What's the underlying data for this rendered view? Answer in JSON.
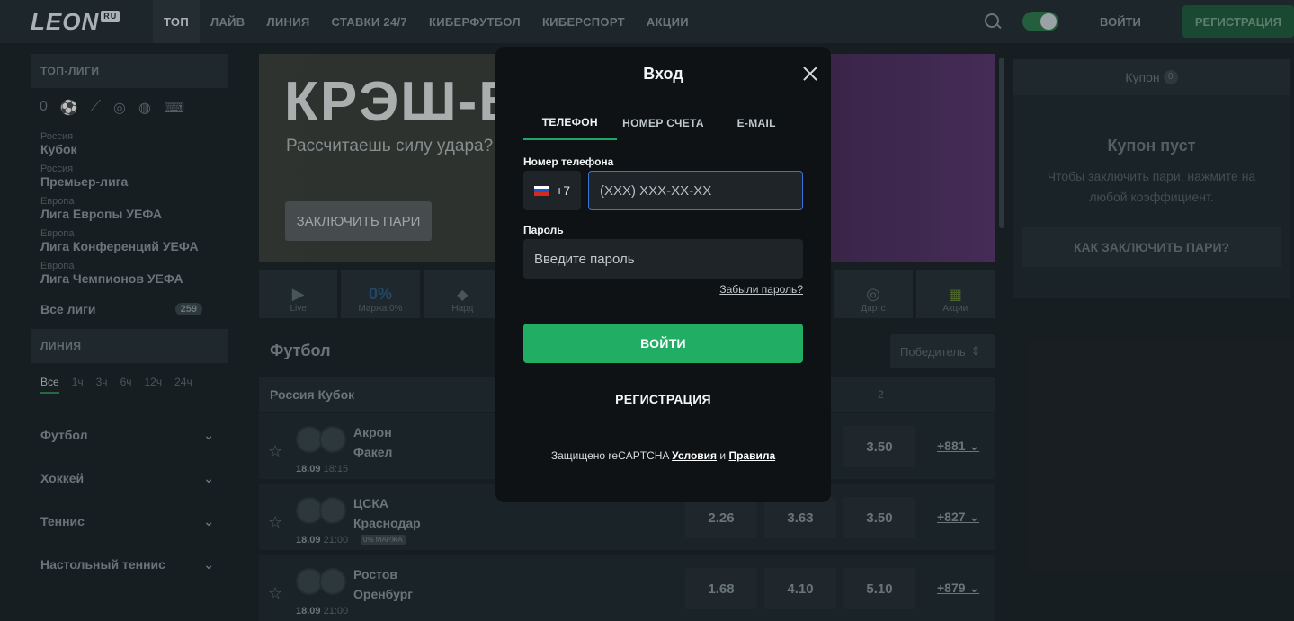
{
  "header": {
    "logo": "LEON",
    "logo_badge": "RU",
    "nav": [
      "ТОП",
      "ЛАЙВ",
      "ЛИНИЯ",
      "СТАВКИ 24/7",
      "КИБЕРФУТБОЛ",
      "КИБЕРСПОРТ",
      "АКЦИИ"
    ],
    "login": "ВОЙТИ",
    "register": "РЕГИСТРАЦИЯ"
  },
  "sidebar": {
    "top_leagues_title": "ТОП-ЛИГИ",
    "leagues": [
      {
        "country": "Россия",
        "name": "Кубок"
      },
      {
        "country": "Россия",
        "name": "Премьер-лига"
      },
      {
        "country": "Европа",
        "name": "Лига Европы УЕФА"
      },
      {
        "country": "Европа",
        "name": "Лига Конференций УЕФА"
      },
      {
        "country": "Европа",
        "name": "Лига Чемпионов УЕФА"
      }
    ],
    "all_leagues": "Все лиги",
    "all_leagues_count": "259",
    "line_title": "ЛИНИЯ",
    "time_filters": [
      "Все",
      "1ч",
      "3ч",
      "6ч",
      "12ч",
      "24ч"
    ],
    "sports": [
      "Футбол",
      "Хоккей",
      "Теннис",
      "Настольный теннис"
    ]
  },
  "banner": {
    "title": "КРЭШ-БО",
    "subtitle": "Рассчитаешь силу удара?",
    "button": "ЗАКЛЮЧИТЬ ПАРИ"
  },
  "quick_links": [
    "Live",
    "Маржа 0%",
    "Нард",
    "",
    "",
    "",
    "",
    "Дартс",
    "Акции"
  ],
  "events": {
    "sport_title": "Футбол",
    "market": "Победитель",
    "league": "Россия Кубок",
    "col_2": "2",
    "matches": [
      {
        "team1": "Акрон",
        "team2": "Факел",
        "date": "18.09",
        "time": "18:15",
        "badge": "",
        "odds": [
          "",
          "",
          "3.50"
        ],
        "more": "+881"
      },
      {
        "team1": "ЦСКА",
        "team2": "Краснодар",
        "date": "18.09",
        "time": "21:00",
        "badge": "0% МАРЖА",
        "odds": [
          "2.26",
          "3.63",
          "3.50"
        ],
        "more": "+827"
      },
      {
        "team1": "Ростов",
        "team2": "Оренбург",
        "date": "18.09",
        "time": "21:00",
        "badge": "",
        "odds": [
          "1.68",
          "4.10",
          "5.10"
        ],
        "more": "+879"
      }
    ]
  },
  "coupon": {
    "title": "Купон",
    "count": "0",
    "empty_title": "Купон пуст",
    "empty_desc": "Чтобы заключить пари, нажмите на любой коэффициент.",
    "how_button": "КАК ЗАКЛЮЧИТЬ ПАРИ?"
  },
  "modal": {
    "title": "Вход",
    "tabs": [
      "ТЕЛЕФОН",
      "НОМЕР СЧЕТА",
      "E-MAIL"
    ],
    "phone_label": "Номер телефона",
    "country_code": "+7",
    "phone_placeholder": "(XXX) XXX-XX-XX",
    "password_label": "Пароль",
    "password_placeholder": "Введите пароль",
    "forgot": "Забыли пароль?",
    "login_button": "ВОЙТИ",
    "register": "РЕГИСТРАЦИЯ",
    "captcha_text": "Защищено reCAPTCHA",
    "captcha_terms": "Условия",
    "captcha_and": "и",
    "captcha_rules": "Правила"
  },
  "colors": {
    "accent": "#22ad64",
    "focus": "#3a73d6",
    "modal_bg": "#0f1214"
  }
}
